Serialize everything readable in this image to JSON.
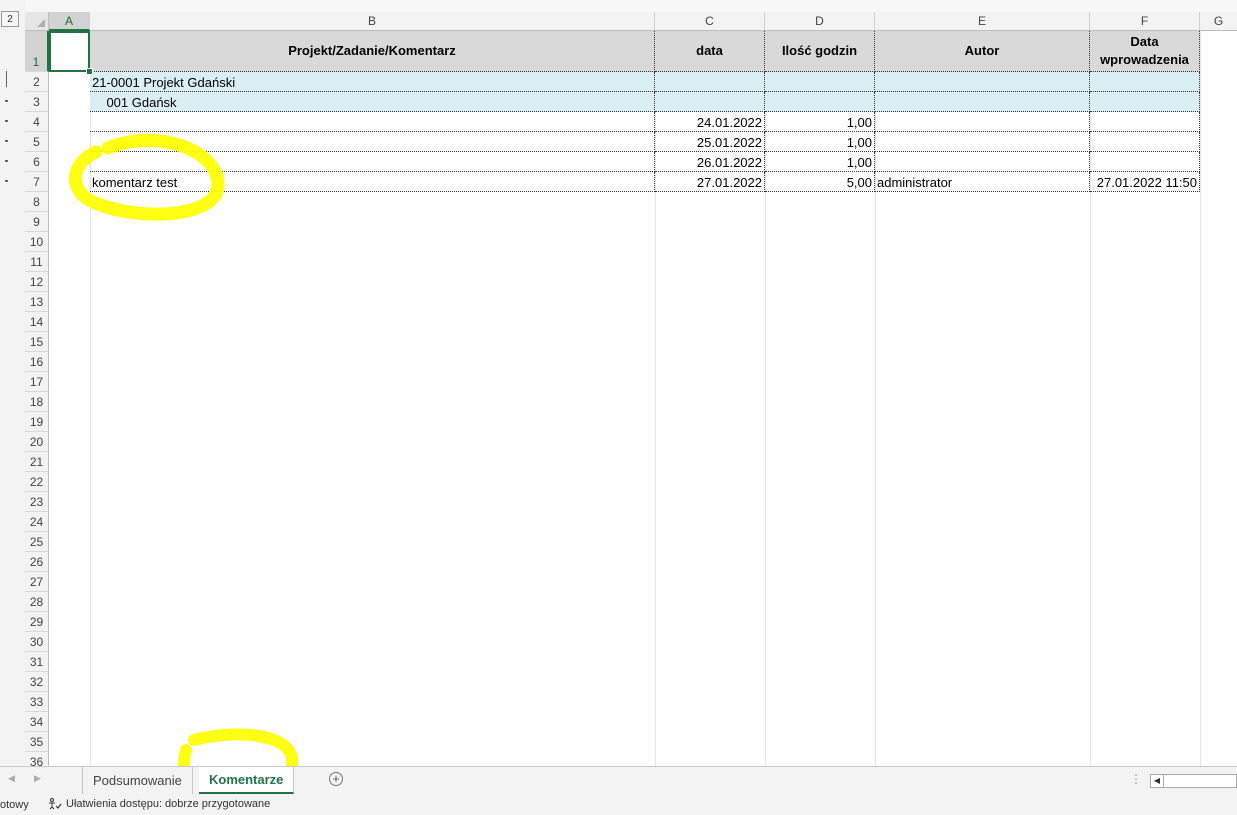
{
  "outline": {
    "level_button": "2"
  },
  "columns": [
    {
      "letter": "A"
    },
    {
      "letter": "B"
    },
    {
      "letter": "C"
    },
    {
      "letter": "D"
    },
    {
      "letter": "E"
    },
    {
      "letter": "F"
    },
    {
      "letter": "G"
    }
  ],
  "rows": [
    "1",
    "2",
    "3",
    "4",
    "5",
    "6",
    "7",
    "8",
    "9",
    "10",
    "11",
    "12",
    "13",
    "14",
    "15",
    "16",
    "17",
    "18",
    "19",
    "20",
    "21",
    "22",
    "23",
    "24",
    "25",
    "26",
    "27",
    "28",
    "29",
    "30",
    "31",
    "32",
    "33",
    "34",
    "35",
    "36"
  ],
  "table": {
    "headers": {
      "b": "Projekt/Zadanie/Komentarz",
      "c": "data",
      "d": "Ilość godzin",
      "e": "Autor",
      "f": "Data wprowadzenia"
    },
    "rows": [
      {
        "b": "21-0001 Projekt Gdański",
        "c": "",
        "d": "",
        "e": "",
        "f": ""
      },
      {
        "b": "    001 Gdańsk",
        "c": "",
        "d": "",
        "e": "",
        "f": ""
      },
      {
        "b": "",
        "c": "24.01.2022",
        "d": "1,00",
        "e": "",
        "f": ""
      },
      {
        "b": "",
        "c": "25.01.2022",
        "d": "1,00",
        "e": "",
        "f": ""
      },
      {
        "b": "",
        "c": "26.01.2022",
        "d": "1,00",
        "e": "",
        "f": ""
      },
      {
        "b": "komentarz test",
        "c": "27.01.2022",
        "d": "5,00",
        "e": "administrator",
        "f": "27.01.2022 11:50"
      }
    ]
  },
  "sheet_tabs": [
    {
      "label": "Podsumowanie",
      "active": false
    },
    {
      "label": "Komentarze",
      "active": true
    }
  ],
  "add_sheet_symbol": "+",
  "status": {
    "ready": "otowy",
    "accessibility": "Ułatwienia dostępu: dobrze przygotowane"
  },
  "colors": {
    "accent": "#217346",
    "header_fill": "#d9d9d9",
    "project_fill": "#daeef3",
    "highlight": "#ffff00"
  },
  "icons": [
    "outline-level-icon",
    "add-sheet-icon",
    "accessibility-icon",
    "scroll-left-icon"
  ]
}
